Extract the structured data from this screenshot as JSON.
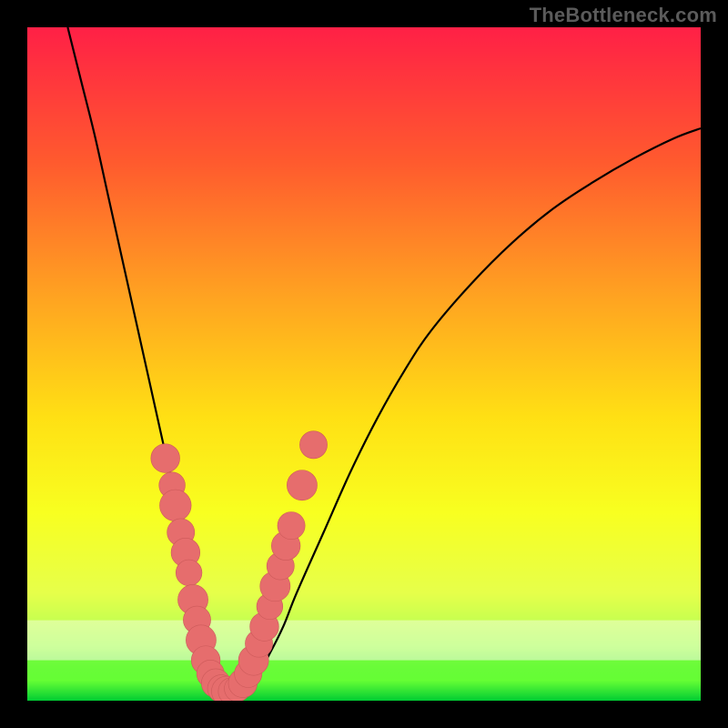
{
  "watermark": "TheBottleneck.com",
  "colors": {
    "frame": "#000000",
    "curve": "#000000",
    "beads": "#e66d6d",
    "beads_stroke": "#cc5a5a",
    "green_band_top": "#66ff33",
    "green_band_bottom": "#00cc33",
    "gradient_stops": [
      {
        "offset": 0.0,
        "color": "#ff2046"
      },
      {
        "offset": 0.2,
        "color": "#ff5a2e"
      },
      {
        "offset": 0.4,
        "color": "#ffa321"
      },
      {
        "offset": 0.58,
        "color": "#ffe014"
      },
      {
        "offset": 0.72,
        "color": "#f8ff20"
      },
      {
        "offset": 0.84,
        "color": "#e6ff4a"
      },
      {
        "offset": 0.92,
        "color": "#aaff55"
      },
      {
        "offset": 1.0,
        "color": "#2fd84a"
      }
    ]
  },
  "chart_data": {
    "type": "line",
    "title": "",
    "xlabel": "",
    "ylabel": "",
    "xlim": [
      0,
      100
    ],
    "ylim": [
      0,
      100
    ],
    "series": [
      {
        "name": "bottleneck-curve",
        "x": [
          6,
          8,
          10,
          12,
          14,
          16,
          18,
          20,
          22,
          24,
          25,
          26,
          27,
          28,
          29,
          30,
          32,
          34,
          36,
          38,
          40,
          44,
          48,
          52,
          56,
          60,
          66,
          72,
          78,
          84,
          90,
          96,
          100
        ],
        "y": [
          100,
          92,
          84,
          75,
          66,
          57,
          48,
          39,
          30,
          20,
          14,
          9,
          5,
          2.5,
          1.5,
          1.2,
          1.6,
          3.5,
          7,
          11,
          16,
          25,
          34,
          42,
          49,
          55,
          62,
          68,
          73,
          77,
          80.5,
          83.5,
          85
        ]
      }
    ],
    "beads": {
      "name": "data-points",
      "points": [
        {
          "x": 20.5,
          "y": 36,
          "r": 1.6
        },
        {
          "x": 21.5,
          "y": 32,
          "r": 1.4
        },
        {
          "x": 22.0,
          "y": 29,
          "r": 1.8
        },
        {
          "x": 22.8,
          "y": 25,
          "r": 1.5
        },
        {
          "x": 23.5,
          "y": 22,
          "r": 1.6
        },
        {
          "x": 24.0,
          "y": 19,
          "r": 1.4
        },
        {
          "x": 24.6,
          "y": 15,
          "r": 1.7
        },
        {
          "x": 25.2,
          "y": 12,
          "r": 1.5
        },
        {
          "x": 25.8,
          "y": 9,
          "r": 1.7
        },
        {
          "x": 26.5,
          "y": 6,
          "r": 1.6
        },
        {
          "x": 27.2,
          "y": 4,
          "r": 1.5
        },
        {
          "x": 28.0,
          "y": 2.6,
          "r": 1.6
        },
        {
          "x": 28.8,
          "y": 1.8,
          "r": 1.5
        },
        {
          "x": 29.6,
          "y": 1.4,
          "r": 1.7
        },
        {
          "x": 30.4,
          "y": 1.4,
          "r": 1.5
        },
        {
          "x": 31.2,
          "y": 1.8,
          "r": 1.4
        },
        {
          "x": 32.0,
          "y": 2.6,
          "r": 1.6
        },
        {
          "x": 32.8,
          "y": 4.0,
          "r": 1.5
        },
        {
          "x": 33.6,
          "y": 6.0,
          "r": 1.7
        },
        {
          "x": 34.4,
          "y": 8.5,
          "r": 1.5
        },
        {
          "x": 35.2,
          "y": 11,
          "r": 1.6
        },
        {
          "x": 36.0,
          "y": 14,
          "r": 1.4
        },
        {
          "x": 36.8,
          "y": 17,
          "r": 1.7
        },
        {
          "x": 37.6,
          "y": 20,
          "r": 1.5
        },
        {
          "x": 38.4,
          "y": 23,
          "r": 1.6
        },
        {
          "x": 39.2,
          "y": 26,
          "r": 1.5
        },
        {
          "x": 40.8,
          "y": 32,
          "r": 1.7
        },
        {
          "x": 42.5,
          "y": 38,
          "r": 1.5
        }
      ]
    },
    "green_band": {
      "y0": 0,
      "y1": 6
    }
  }
}
